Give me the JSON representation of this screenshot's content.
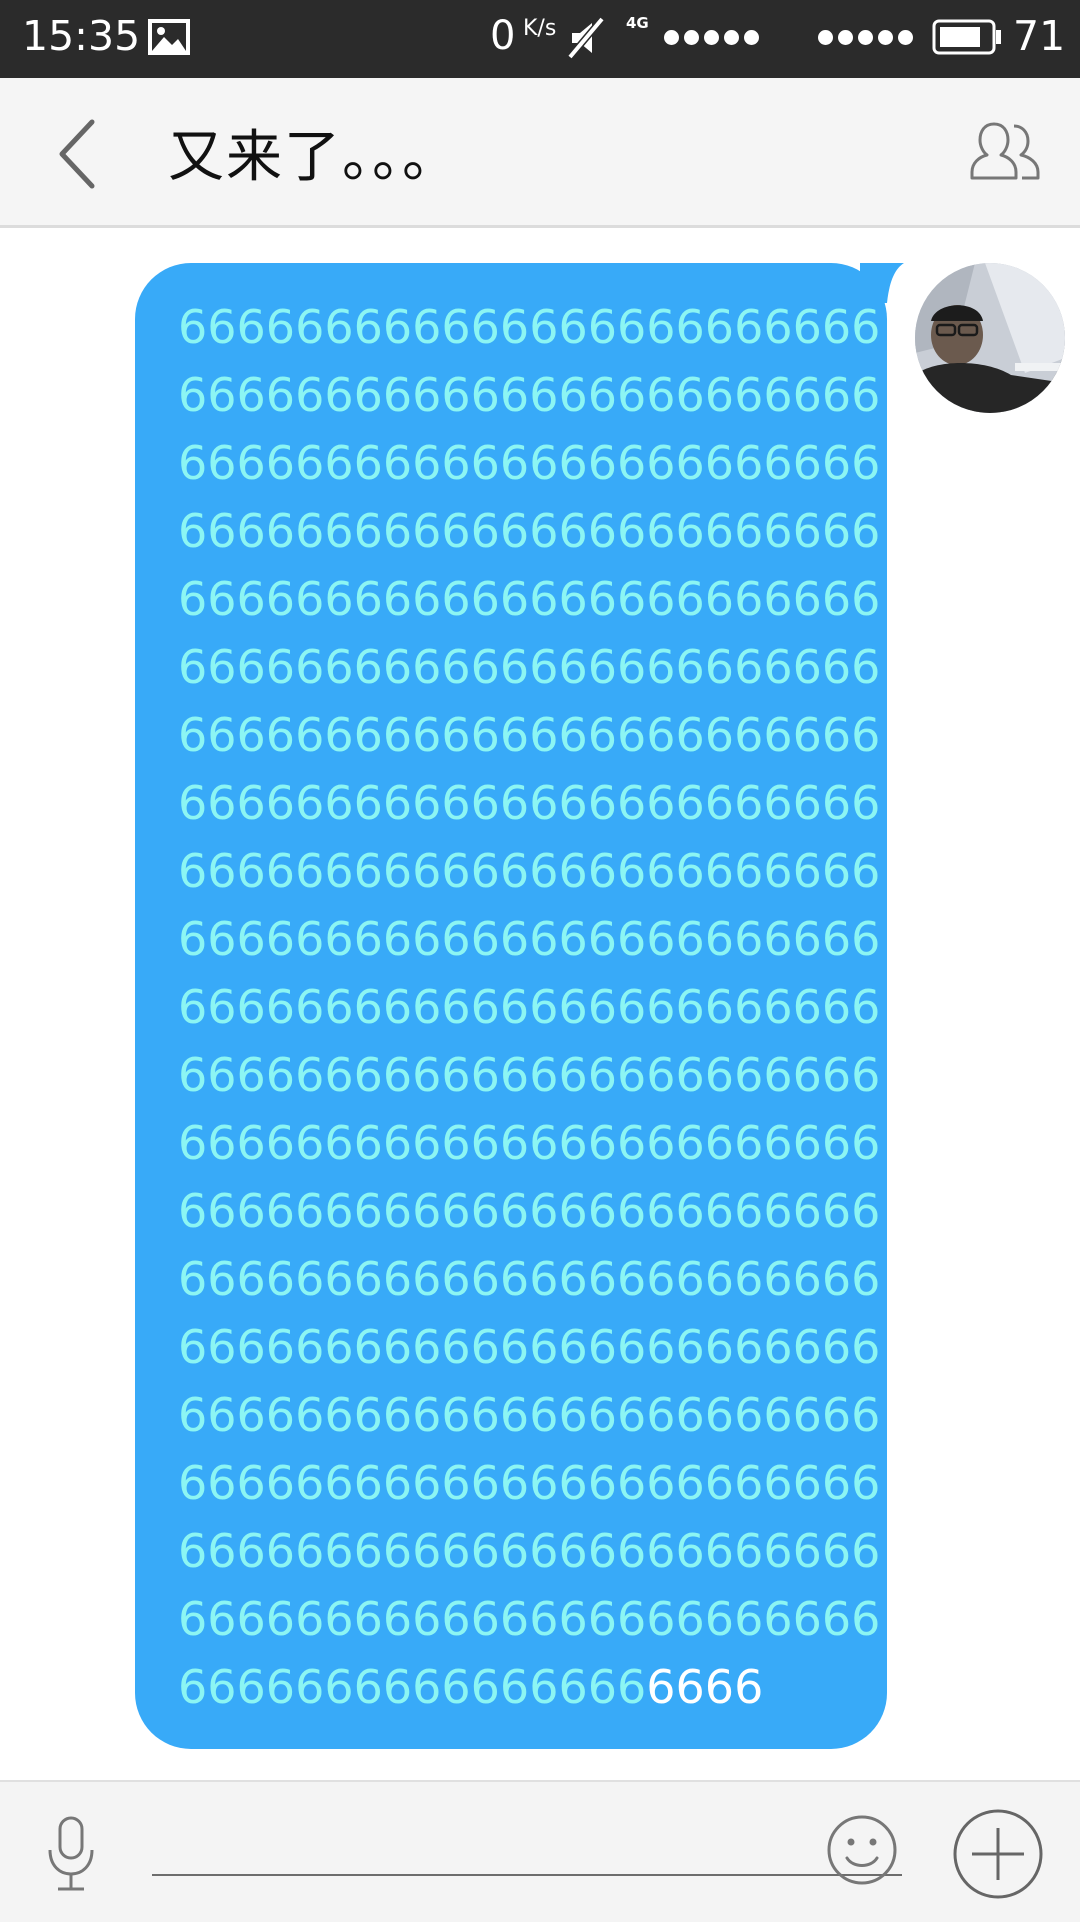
{
  "status_bar": {
    "time": "15:35",
    "net_speed": "0",
    "net_speed_unit": "K/s",
    "network_type": "4G",
    "battery": "71",
    "icons": [
      "gallery-icon",
      "mute-icon",
      "signal-dots-icon",
      "battery-icon"
    ]
  },
  "header": {
    "title": "又来了。。。",
    "back_icon": "chevron-left-icon",
    "members_icon": "group-members-icon"
  },
  "messages": [
    {
      "sender": "self",
      "lines": [
        "666666666666666666666666",
        "666666666666666666666666",
        "666666666666666666666666",
        "666666666666666666666666",
        "666666666666666666666666",
        "666666666666666666666666",
        "666666666666666666666666",
        "666666666666666666666666",
        "666666666666666666666666",
        "666666666666666666666666",
        "666666666666666666666666",
        "666666666666666666666666",
        "666666666666666666666666",
        "666666666666666666666666",
        "666666666666666666666666",
        "666666666666666666666666",
        "666666666666666666666666",
        "666666666666666666666666",
        "666666666666666666666666",
        "666666666666666666666666"
      ],
      "last_line": "6666666666666666",
      "last_line_tail": "6666",
      "bubble_color": "#38aaf8",
      "text_color": "#8cf5f3"
    }
  ],
  "input_bar": {
    "value": "",
    "icons": [
      "microphone-icon",
      "smiley-icon",
      "plus-circle-icon"
    ]
  }
}
